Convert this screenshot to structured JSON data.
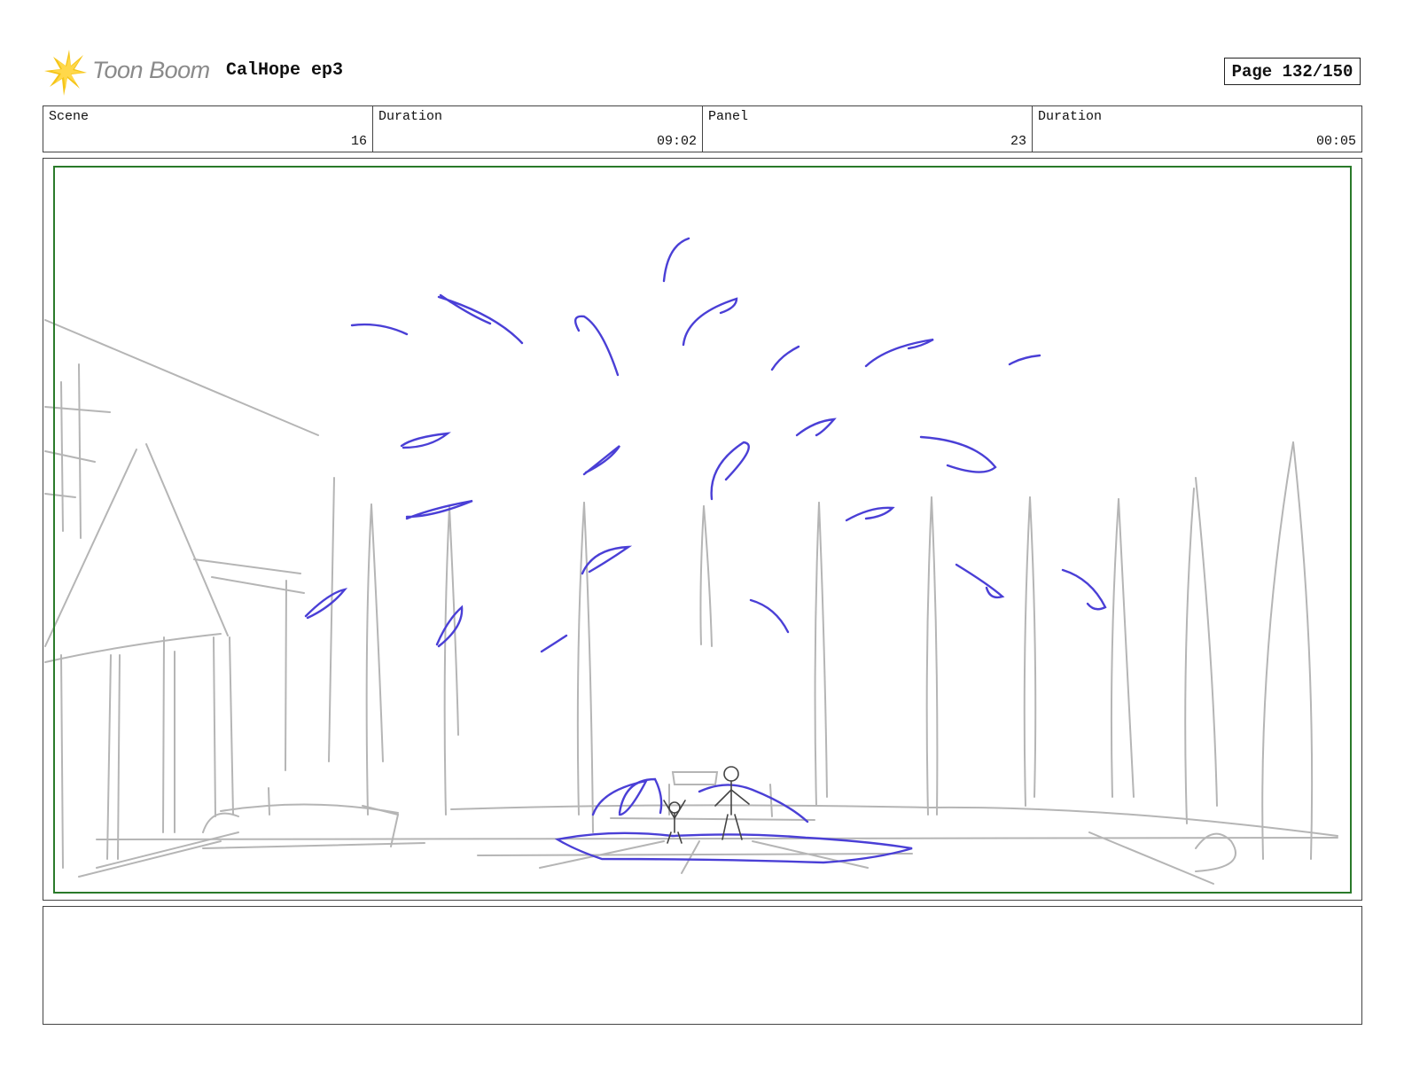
{
  "header": {
    "logo_text": "Toon Boom",
    "project_title": "CalHope ep3",
    "page_label": "Page 132/150"
  },
  "info": {
    "scene_label": "Scene",
    "scene_value": "16",
    "scene_duration_label": "Duration",
    "scene_duration_value": "09:02",
    "panel_label": "Panel",
    "panel_value": "23",
    "panel_duration_label": "Duration",
    "panel_duration_value": "00:05"
  },
  "notes": {
    "text": ""
  },
  "colors": {
    "logo_yellow": "#f5c518",
    "safe_frame": "#2a7a2a",
    "splash_blue": "#4a3fd6",
    "sketch_gray": "#b5b5b5"
  }
}
